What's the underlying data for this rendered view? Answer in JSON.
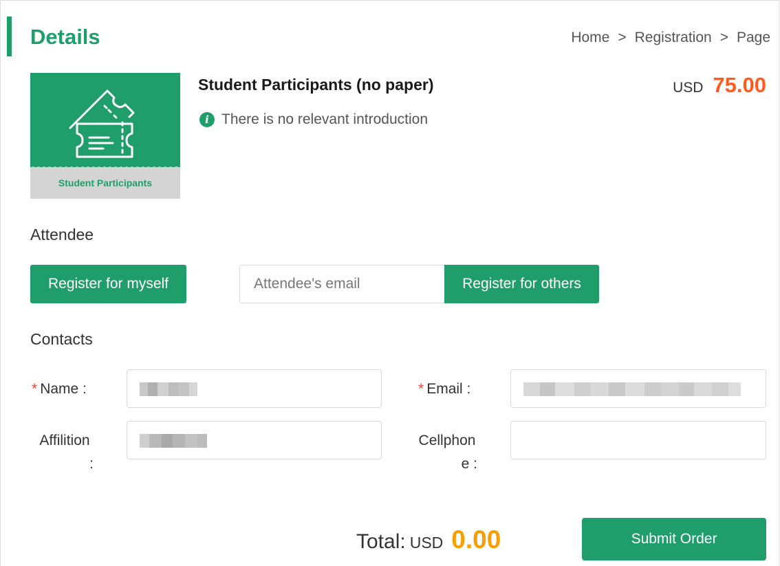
{
  "header": {
    "title": "Details",
    "breadcrumb": [
      "Home",
      ">",
      "Registration",
      ">",
      "Page"
    ]
  },
  "product": {
    "image_label": "Student Participants",
    "name": "Student Participants (no paper)",
    "intro": "There is no relevant introduction",
    "currency": "USD",
    "price": "75.00"
  },
  "attendee": {
    "section_label": "Attendee",
    "self_button": "Register for myself",
    "email_placeholder": "Attendee's email",
    "others_button": "Register for others"
  },
  "contacts": {
    "section_label": "Contacts",
    "name_label": "Name :",
    "email_label": "Email :",
    "affiliation_label_line1": "Affilition",
    "affiliation_label_line2": ":",
    "cellphone_label_line1": "Cellphon",
    "cellphone_label_line2": "e :",
    "required_mark": "*"
  },
  "footer": {
    "total_label": "Total:",
    "currency": "USD",
    "total_amount": "0.00",
    "submit_button": "Submit Order"
  },
  "colors": {
    "brand_green": "#1f9d6b",
    "price_orange": "#ff5a1f",
    "total_amber": "#f5a000",
    "required_red": "#e8443a"
  },
  "icons": {
    "ticket": "ticket-icon",
    "info": "info-icon"
  }
}
